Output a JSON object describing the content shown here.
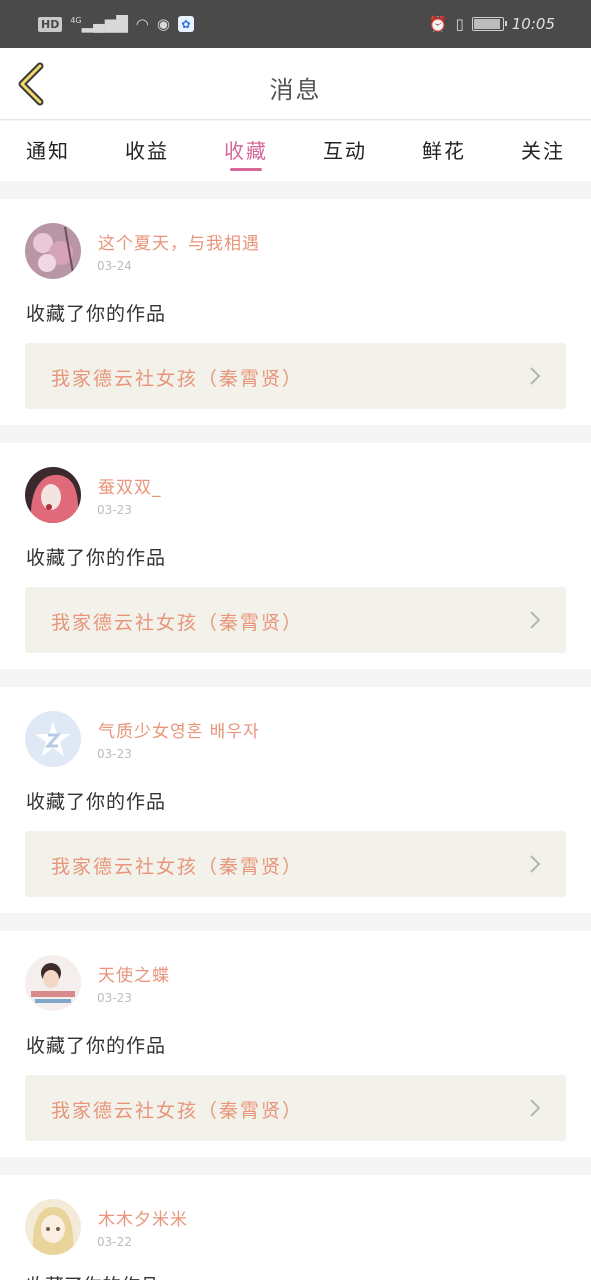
{
  "status_bar": {
    "left_badges": [
      "HD",
      "4G"
    ],
    "time": "10:05",
    "icons": [
      "hd-icon",
      "signal-icon",
      "wifi-icon",
      "eye-icon",
      "baidu-icon",
      "alarm-icon",
      "vibrate-icon",
      "battery-icon"
    ]
  },
  "header": {
    "title": "消息"
  },
  "tabs": [
    {
      "label": "通知"
    },
    {
      "label": "收益"
    },
    {
      "label": "收藏"
    },
    {
      "label": "互动"
    },
    {
      "label": "鲜花"
    },
    {
      "label": "关注"
    }
  ],
  "active_tab": "收藏",
  "colors": {
    "accent": "#d5679b",
    "name": "#e8957b",
    "card_link_bg": "#f3f2ea"
  },
  "items": [
    {
      "username": "这个夏天，与我相遇",
      "date": "03-24",
      "action": "收藏了你的作品",
      "work": "我家德云社女孩（秦霄贤）"
    },
    {
      "username": "蚕双双_",
      "date": "03-23",
      "action": "收藏了你的作品",
      "work": "我家德云社女孩（秦霄贤）"
    },
    {
      "username": "气质少女영혼 배우자",
      "date": "03-23",
      "action": "收藏了你的作品",
      "work": "我家德云社女孩（秦霄贤）"
    },
    {
      "username": "天使之蝶",
      "date": "03-23",
      "action": "收藏了你的作品",
      "work": "我家德云社女孩（秦霄贤）"
    },
    {
      "username": "木木夕米米",
      "date": "03-22",
      "action": "收藏了你的作品"
    }
  ]
}
